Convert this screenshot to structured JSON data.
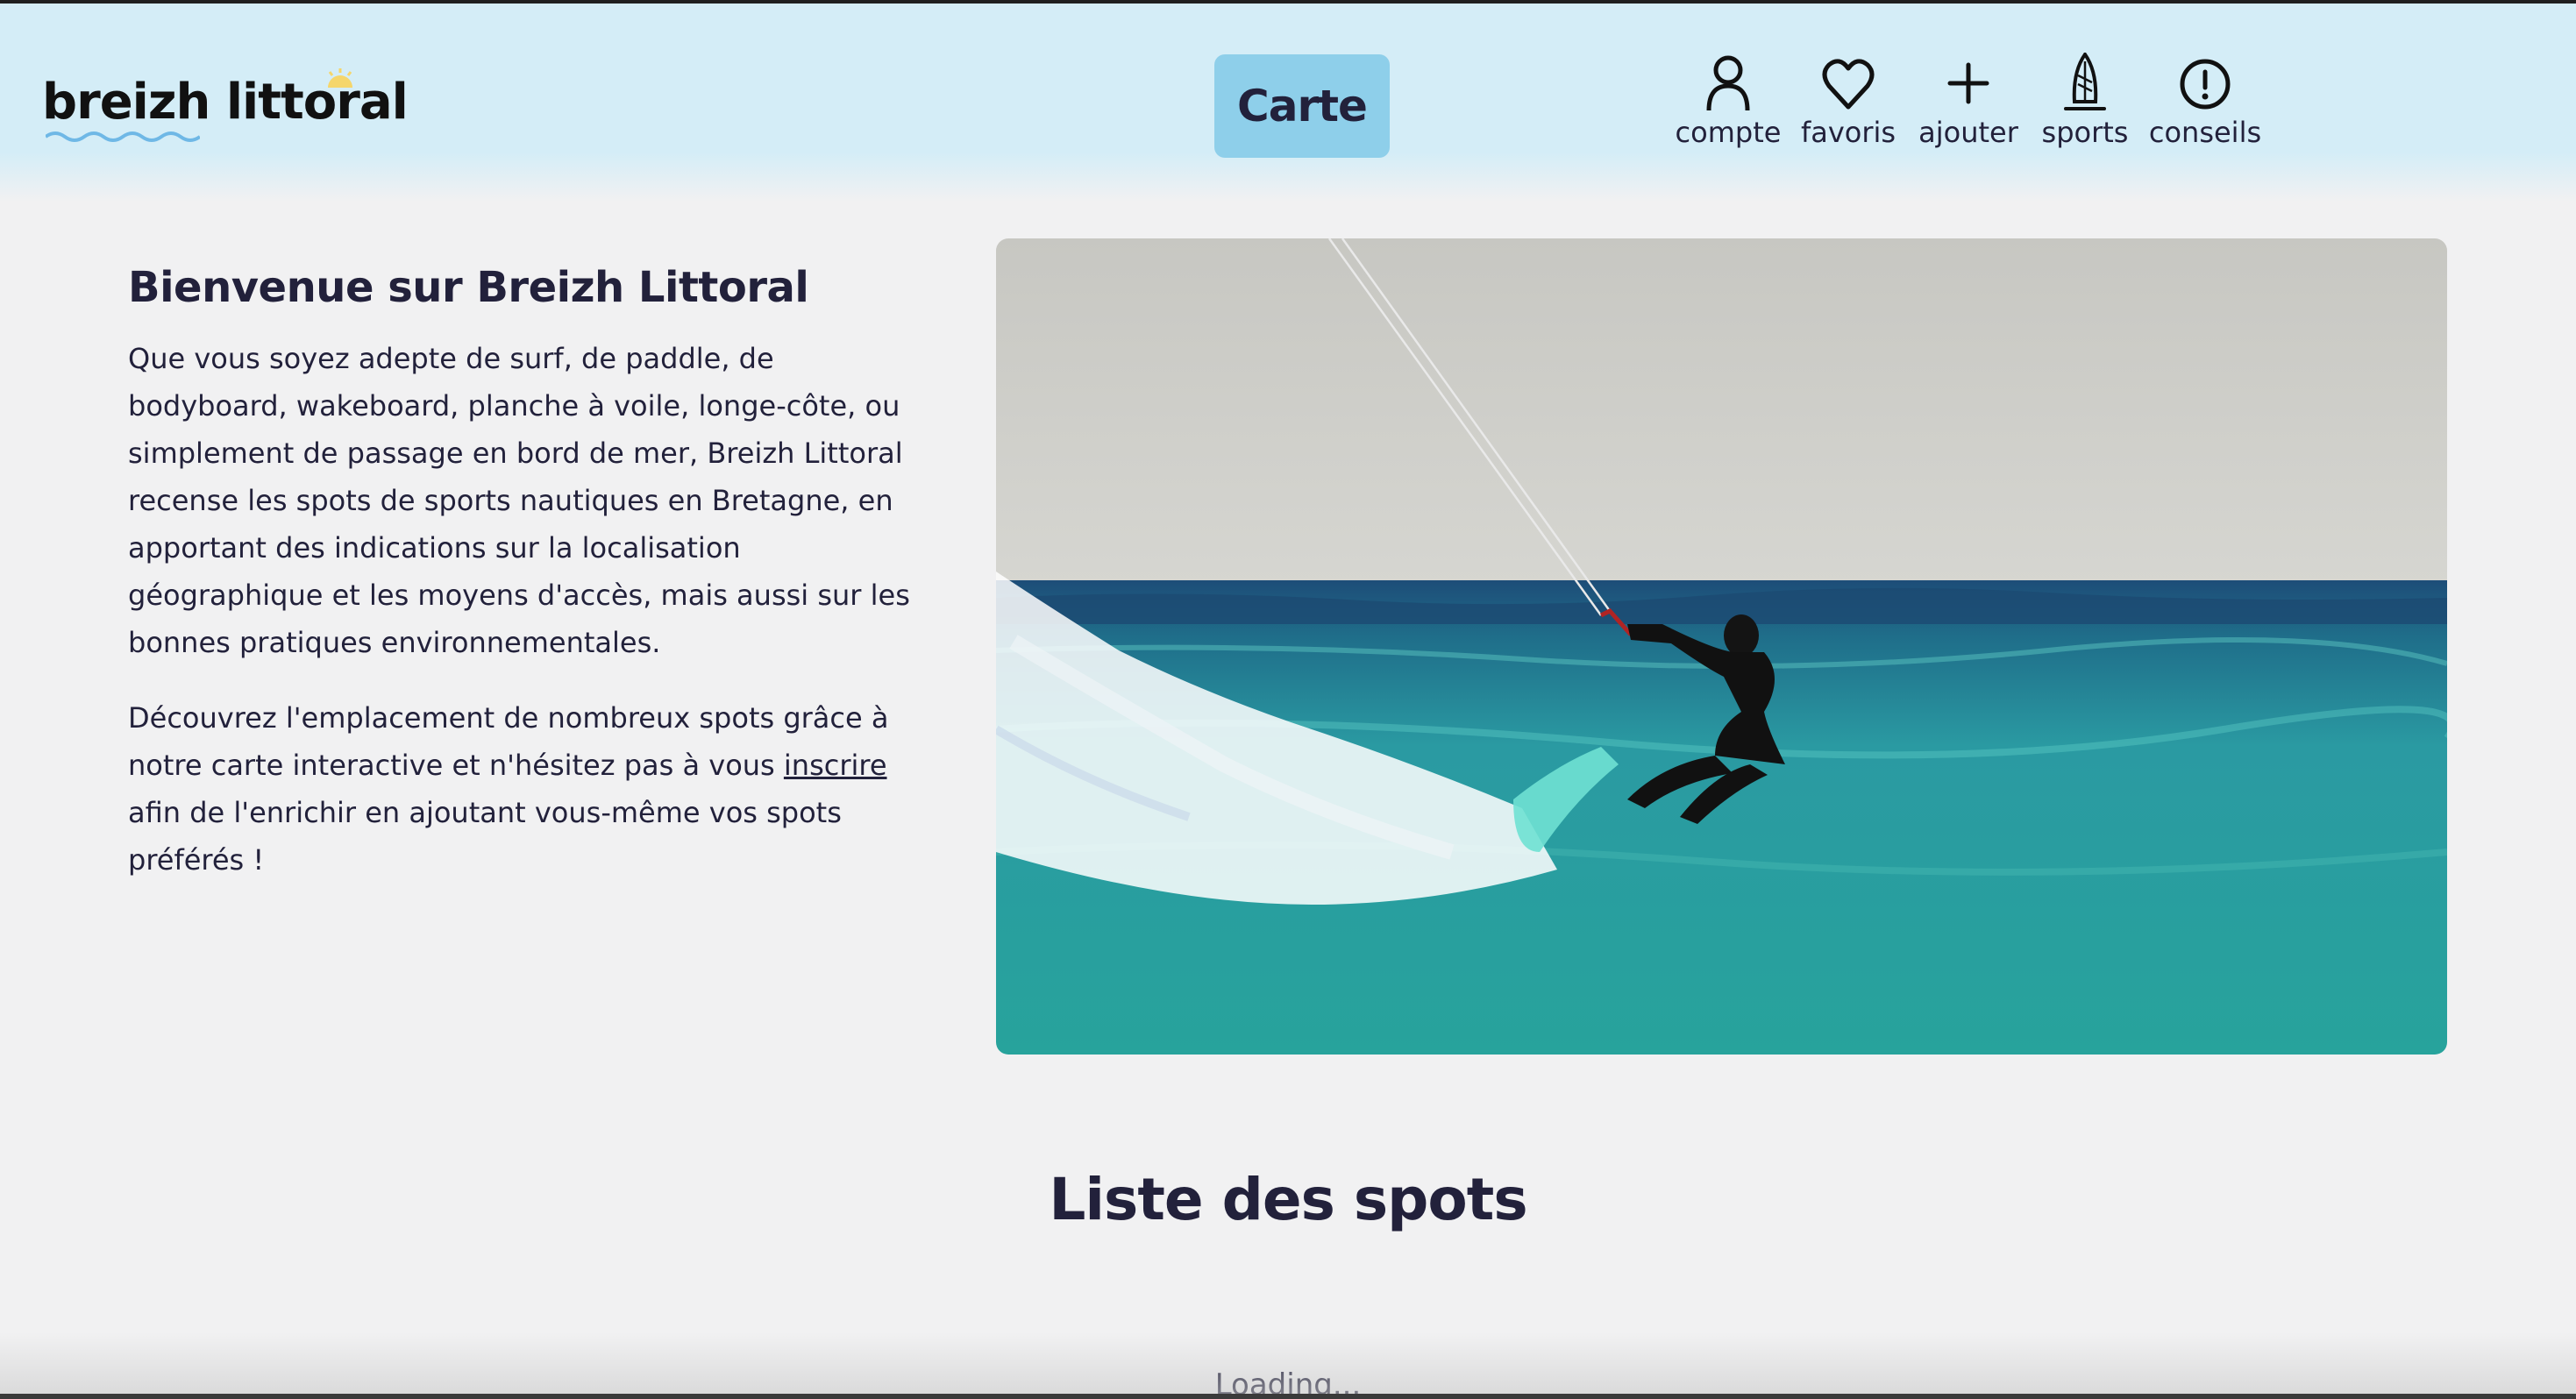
{
  "header": {
    "logo_text": "breizh littoral",
    "carte_label": "Carte",
    "nav": [
      {
        "label": "compte",
        "icon": "user-icon"
      },
      {
        "label": "favoris",
        "icon": "heart-icon"
      },
      {
        "label": "ajouter",
        "icon": "plus-icon"
      },
      {
        "label": "sports",
        "icon": "surfboard-icon"
      },
      {
        "label": "conseils",
        "icon": "alert-circle-icon"
      }
    ]
  },
  "intro": {
    "title": "Bienvenue sur Breizh Littoral",
    "paragraph1": "Que vous soyez adepte de surf, de paddle, de bodyboard, wakeboard, planche à voile, longe-côte, ou simplement de passage en bord de mer, Breizh Littoral recense les spots de sports nautiques en Bretagne, en apportant des indications sur la localisation géographique et les moyens d'accès, mais aussi sur les bonnes pratiques environnementales.",
    "paragraph2_before": "Découvrez l'emplacement de nombreux spots grâce à notre carte interactive et n'hésitez pas à vous ",
    "paragraph2_link": "inscrire",
    "paragraph2_after": " afin de l'enrichir en ajoutant vous-même vos spots préférés !"
  },
  "list": {
    "title": "Liste des spots",
    "loading": "Loading..."
  },
  "colors": {
    "header_bg": "#d4edf7",
    "accent_button": "#8ecfea",
    "text": "#22213b",
    "page_bg": "#f1f1f2"
  }
}
